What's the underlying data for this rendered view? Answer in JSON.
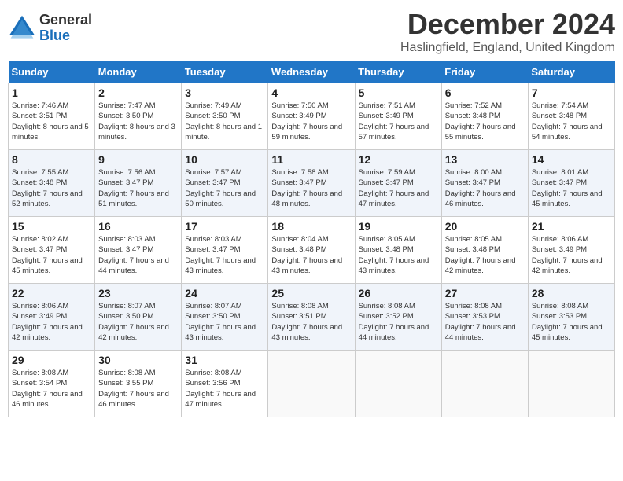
{
  "header": {
    "logo_line1": "General",
    "logo_line2": "Blue",
    "month_title": "December 2024",
    "subtitle": "Haslingfield, England, United Kingdom"
  },
  "days_of_week": [
    "Sunday",
    "Monday",
    "Tuesday",
    "Wednesday",
    "Thursday",
    "Friday",
    "Saturday"
  ],
  "weeks": [
    [
      {
        "day": 1,
        "sunrise": "7:46 AM",
        "sunset": "3:51 PM",
        "daylight": "8 hours and 5 minutes."
      },
      {
        "day": 2,
        "sunrise": "7:47 AM",
        "sunset": "3:50 PM",
        "daylight": "8 hours and 3 minutes."
      },
      {
        "day": 3,
        "sunrise": "7:49 AM",
        "sunset": "3:50 PM",
        "daylight": "8 hours and 1 minute."
      },
      {
        "day": 4,
        "sunrise": "7:50 AM",
        "sunset": "3:49 PM",
        "daylight": "7 hours and 59 minutes."
      },
      {
        "day": 5,
        "sunrise": "7:51 AM",
        "sunset": "3:49 PM",
        "daylight": "7 hours and 57 minutes."
      },
      {
        "day": 6,
        "sunrise": "7:52 AM",
        "sunset": "3:48 PM",
        "daylight": "7 hours and 55 minutes."
      },
      {
        "day": 7,
        "sunrise": "7:54 AM",
        "sunset": "3:48 PM",
        "daylight": "7 hours and 54 minutes."
      }
    ],
    [
      {
        "day": 8,
        "sunrise": "7:55 AM",
        "sunset": "3:48 PM",
        "daylight": "7 hours and 52 minutes."
      },
      {
        "day": 9,
        "sunrise": "7:56 AM",
        "sunset": "3:47 PM",
        "daylight": "7 hours and 51 minutes."
      },
      {
        "day": 10,
        "sunrise": "7:57 AM",
        "sunset": "3:47 PM",
        "daylight": "7 hours and 50 minutes."
      },
      {
        "day": 11,
        "sunrise": "7:58 AM",
        "sunset": "3:47 PM",
        "daylight": "7 hours and 48 minutes."
      },
      {
        "day": 12,
        "sunrise": "7:59 AM",
        "sunset": "3:47 PM",
        "daylight": "7 hours and 47 minutes."
      },
      {
        "day": 13,
        "sunrise": "8:00 AM",
        "sunset": "3:47 PM",
        "daylight": "7 hours and 46 minutes."
      },
      {
        "day": 14,
        "sunrise": "8:01 AM",
        "sunset": "3:47 PM",
        "daylight": "7 hours and 45 minutes."
      }
    ],
    [
      {
        "day": 15,
        "sunrise": "8:02 AM",
        "sunset": "3:47 PM",
        "daylight": "7 hours and 45 minutes."
      },
      {
        "day": 16,
        "sunrise": "8:03 AM",
        "sunset": "3:47 PM",
        "daylight": "7 hours and 44 minutes."
      },
      {
        "day": 17,
        "sunrise": "8:03 AM",
        "sunset": "3:47 PM",
        "daylight": "7 hours and 43 minutes."
      },
      {
        "day": 18,
        "sunrise": "8:04 AM",
        "sunset": "3:48 PM",
        "daylight": "7 hours and 43 minutes."
      },
      {
        "day": 19,
        "sunrise": "8:05 AM",
        "sunset": "3:48 PM",
        "daylight": "7 hours and 43 minutes."
      },
      {
        "day": 20,
        "sunrise": "8:05 AM",
        "sunset": "3:48 PM",
        "daylight": "7 hours and 42 minutes."
      },
      {
        "day": 21,
        "sunrise": "8:06 AM",
        "sunset": "3:49 PM",
        "daylight": "7 hours and 42 minutes."
      }
    ],
    [
      {
        "day": 22,
        "sunrise": "8:06 AM",
        "sunset": "3:49 PM",
        "daylight": "7 hours and 42 minutes."
      },
      {
        "day": 23,
        "sunrise": "8:07 AM",
        "sunset": "3:50 PM",
        "daylight": "7 hours and 42 minutes."
      },
      {
        "day": 24,
        "sunrise": "8:07 AM",
        "sunset": "3:50 PM",
        "daylight": "7 hours and 43 minutes."
      },
      {
        "day": 25,
        "sunrise": "8:08 AM",
        "sunset": "3:51 PM",
        "daylight": "7 hours and 43 minutes."
      },
      {
        "day": 26,
        "sunrise": "8:08 AM",
        "sunset": "3:52 PM",
        "daylight": "7 hours and 44 minutes."
      },
      {
        "day": 27,
        "sunrise": "8:08 AM",
        "sunset": "3:53 PM",
        "daylight": "7 hours and 44 minutes."
      },
      {
        "day": 28,
        "sunrise": "8:08 AM",
        "sunset": "3:53 PM",
        "daylight": "7 hours and 45 minutes."
      }
    ],
    [
      {
        "day": 29,
        "sunrise": "8:08 AM",
        "sunset": "3:54 PM",
        "daylight": "7 hours and 46 minutes."
      },
      {
        "day": 30,
        "sunrise": "8:08 AM",
        "sunset": "3:55 PM",
        "daylight": "7 hours and 46 minutes."
      },
      {
        "day": 31,
        "sunrise": "8:08 AM",
        "sunset": "3:56 PM",
        "daylight": "7 hours and 47 minutes."
      },
      null,
      null,
      null,
      null
    ]
  ]
}
